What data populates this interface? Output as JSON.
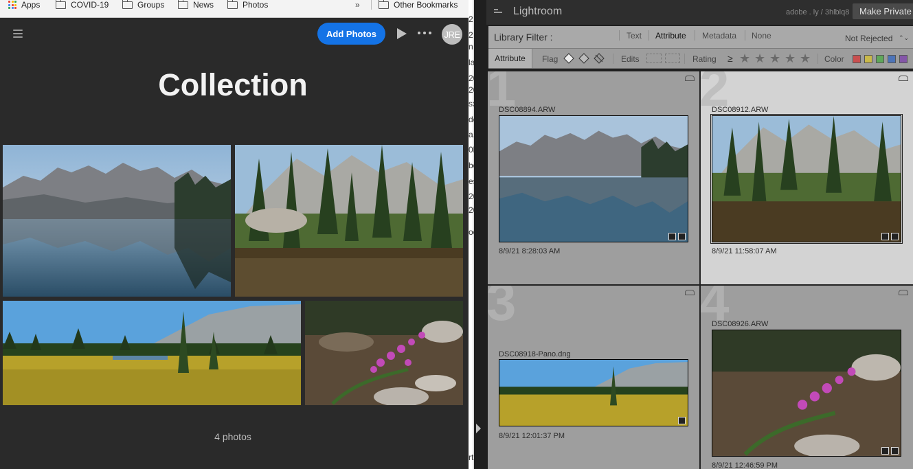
{
  "bookmarks": {
    "apps_label": "Apps",
    "items": [
      "COVID-19",
      "Groups",
      "News",
      "Photos"
    ],
    "overflow": "»",
    "other": "Other Bookmarks"
  },
  "header": {
    "add_label": "Add Photos",
    "avatar_initials": "JRE"
  },
  "collection": {
    "title": "Collection",
    "count": "4 photos"
  },
  "strip_fragments": [
    "2",
    "2",
    "n",
    "la",
    "20",
    "20",
    "sx",
    "dc",
    "a.x",
    "0k",
    "bo",
    "es",
    "20",
    "20",
    "oe",
    "rt"
  ],
  "lightroom": {
    "title": "Lightroom",
    "share_url": "adobe . ly / 3hlblq8",
    "make_private": "Make Private",
    "library_filter": {
      "label": "Library Filter :",
      "options": [
        "Text",
        "Attribute",
        "Metadata",
        "None"
      ],
      "active": "Attribute",
      "dropdown": "Not Rejected"
    },
    "attribute_bar": {
      "tab": "Attribute",
      "flag": "Flag",
      "edits": "Edits",
      "rating": "Rating",
      "rating_op": "≥",
      "color": "Color",
      "swatches": [
        "#c94f4f",
        "#c9b94a",
        "#5fa85a",
        "#4d74b8",
        "#8456a8"
      ]
    },
    "cells": [
      {
        "num": "1",
        "name": "DSC08894.ARW",
        "date": "8/9/21 8:28:03 AM"
      },
      {
        "num": "2",
        "name": "DSC08912.ARW",
        "date": "8/9/21 11:58:07 AM"
      },
      {
        "num": "3",
        "name": "DSC08918-Pano.dng",
        "date": "8/9/21 12:01:37 PM"
      },
      {
        "num": "4",
        "name": "DSC08926.ARW",
        "date": "8/9/21 12:46:59 PM"
      }
    ]
  }
}
